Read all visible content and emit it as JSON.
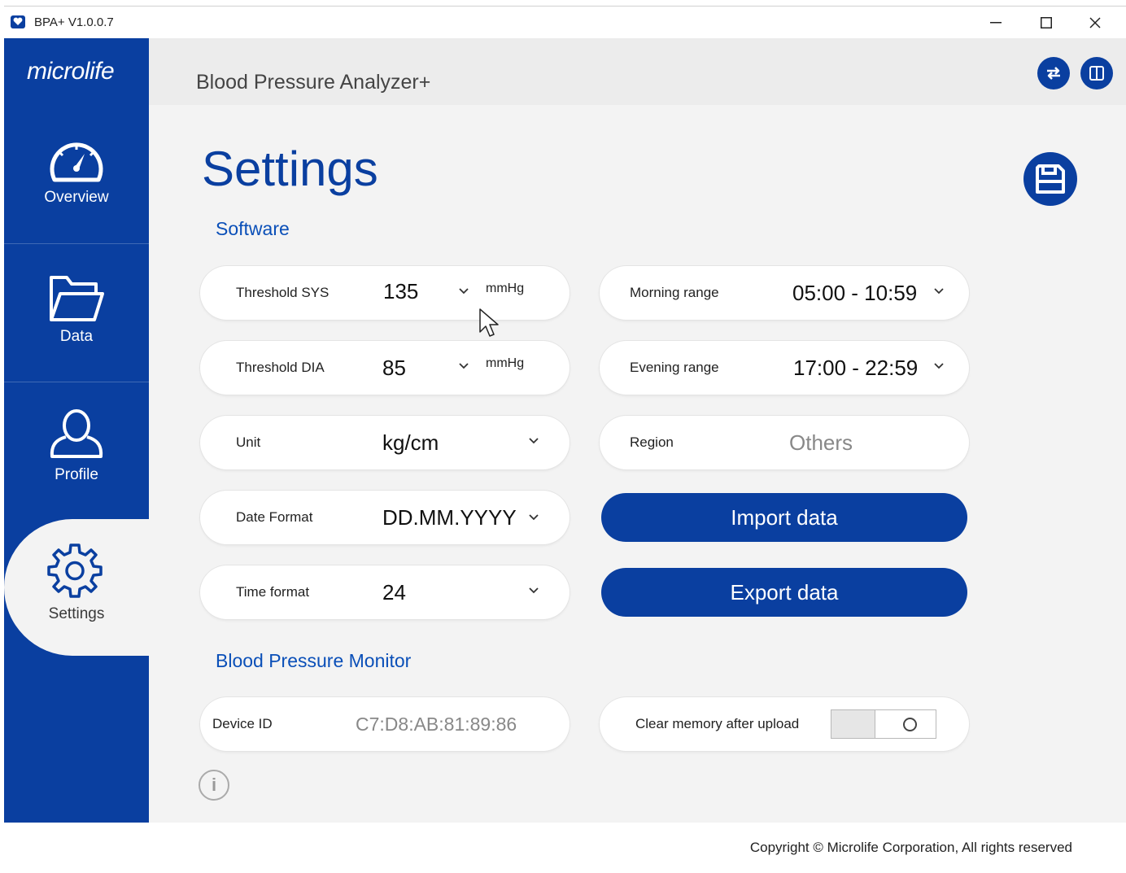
{
  "window": {
    "title": "BPA+ V1.0.0.7",
    "minimize": "–",
    "maximize": "☐",
    "close": "✕"
  },
  "sidebar": {
    "logo": "microlife",
    "items": [
      {
        "label": "Overview",
        "icon": "gauge-icon"
      },
      {
        "label": "Data",
        "icon": "folder-icon"
      },
      {
        "label": "Profile",
        "icon": "user-icon"
      },
      {
        "label": "Settings",
        "icon": "gear-icon",
        "active": true
      }
    ]
  },
  "header": {
    "title": "Blood Pressure Analyzer+",
    "buttons": [
      "swap-icon",
      "book-icon"
    ]
  },
  "page": {
    "title": "Settings",
    "software_section": "Software",
    "bpm_section": "Blood Pressure Monitor"
  },
  "software": {
    "threshold_sys": {
      "label": "Threshold SYS",
      "value": "135",
      "unit": "mmHg"
    },
    "threshold_dia": {
      "label": "Threshold DIA",
      "value": "85",
      "unit": "mmHg"
    },
    "unit": {
      "label": "Unit",
      "value": "kg/cm"
    },
    "date_format": {
      "label": "Date Format",
      "value": "DD.MM.YYYY"
    },
    "time_format": {
      "label": "Time format",
      "value": "24"
    },
    "morning_range": {
      "label": "Morning range",
      "value": "05:00 - 10:59"
    },
    "evening_range": {
      "label": "Evening range",
      "value": "17:00 - 22:59"
    },
    "region": {
      "label": "Region",
      "value": "Others"
    },
    "import_label": "Import data",
    "export_label": "Export data"
  },
  "monitor": {
    "device_id": {
      "label": "Device ID",
      "value": "C7:D8:AB:81:89:86"
    },
    "clear_memory": {
      "label": "Clear memory after upload",
      "enabled": false
    }
  },
  "info_icon": "i",
  "footer": {
    "copyright": "Copyright © Microlife Corporation, All rights reserved"
  },
  "colors": {
    "brand": "#0a3fa0",
    "background": "#f3f3f3",
    "section": "#0a4fb8"
  }
}
